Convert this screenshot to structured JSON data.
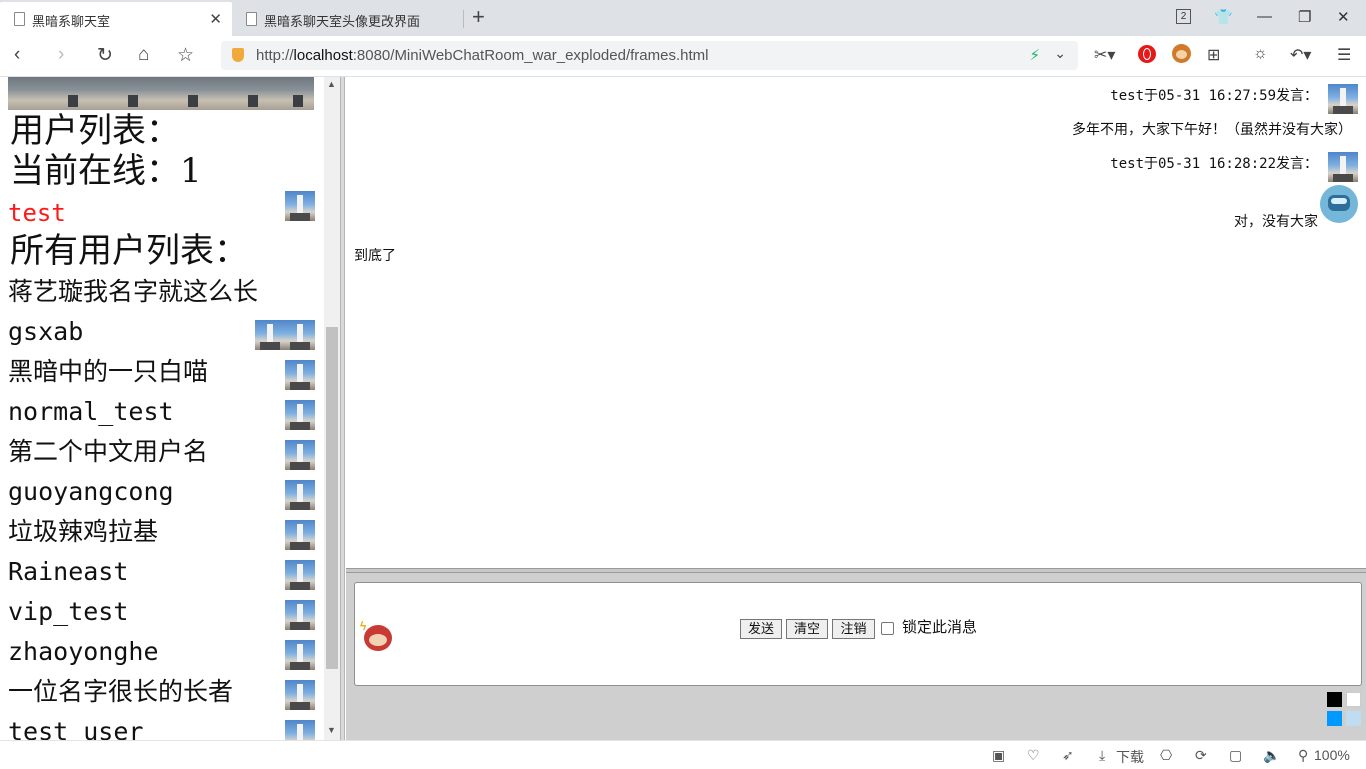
{
  "browser": {
    "tabs": [
      {
        "title": "黑暗系聊天室",
        "active": true
      },
      {
        "title": "黑暗系聊天室头像更改界面",
        "active": false
      }
    ],
    "tab_count_badge": "2",
    "url_prefix": "http://",
    "url_host": "localhost",
    "url_rest": ":8080/MiniWebChatRoom_war_exploded/frames.html",
    "download_label": "下载",
    "zoom": "100%"
  },
  "sidebar": {
    "user_list_title": "用户列表：",
    "online_count_label": "当前在线：1",
    "online_users": [
      "test"
    ],
    "all_users_title": "所有用户列表：",
    "all_users": [
      {
        "name": "蒋艺璇我名字就这么长",
        "script": "cn",
        "avatars": 0
      },
      {
        "name": "gsxab",
        "script": "en",
        "avatars": 2
      },
      {
        "name": "黑暗中的一只白喵",
        "script": "cn",
        "avatars": 1
      },
      {
        "name": "normal_test",
        "script": "en",
        "avatars": 1
      },
      {
        "name": "第二个中文用户名",
        "script": "cn",
        "avatars": 1
      },
      {
        "name": "guoyangcong",
        "script": "en",
        "avatars": 1
      },
      {
        "name": "垃圾辣鸡拉基",
        "script": "cn",
        "avatars": 1
      },
      {
        "name": "Raineast",
        "script": "en",
        "avatars": 1
      },
      {
        "name": "vip_test",
        "script": "en",
        "avatars": 1
      },
      {
        "name": "zhaoyonghe",
        "script": "en",
        "avatars": 1
      },
      {
        "name": "一位名字很长的长者",
        "script": "cn",
        "avatars": 1
      },
      {
        "name": "test_user",
        "script": "en",
        "avatars": 1
      }
    ]
  },
  "chat": {
    "messages": [
      {
        "header": "test于05-31 16:27:59发言：",
        "text": "多年不用，大家下午好！（虽然并没有大家）"
      },
      {
        "header": "test于05-31 16:28:22发言：",
        "text": "对，没有大家"
      }
    ],
    "end_notice": "到底了"
  },
  "composer": {
    "message_value": "",
    "send_label": "发送",
    "clear_label": "清空",
    "logout_label": "注销",
    "lock_label": "锁定此消息",
    "lock_checked": false,
    "color_swatches": [
      "#000000",
      "#ffffff",
      "#0099ff",
      "#bfdcf0"
    ]
  },
  "colors": {
    "online_user": "#ff1a1a",
    "tab_strip": "#dee1e6"
  }
}
